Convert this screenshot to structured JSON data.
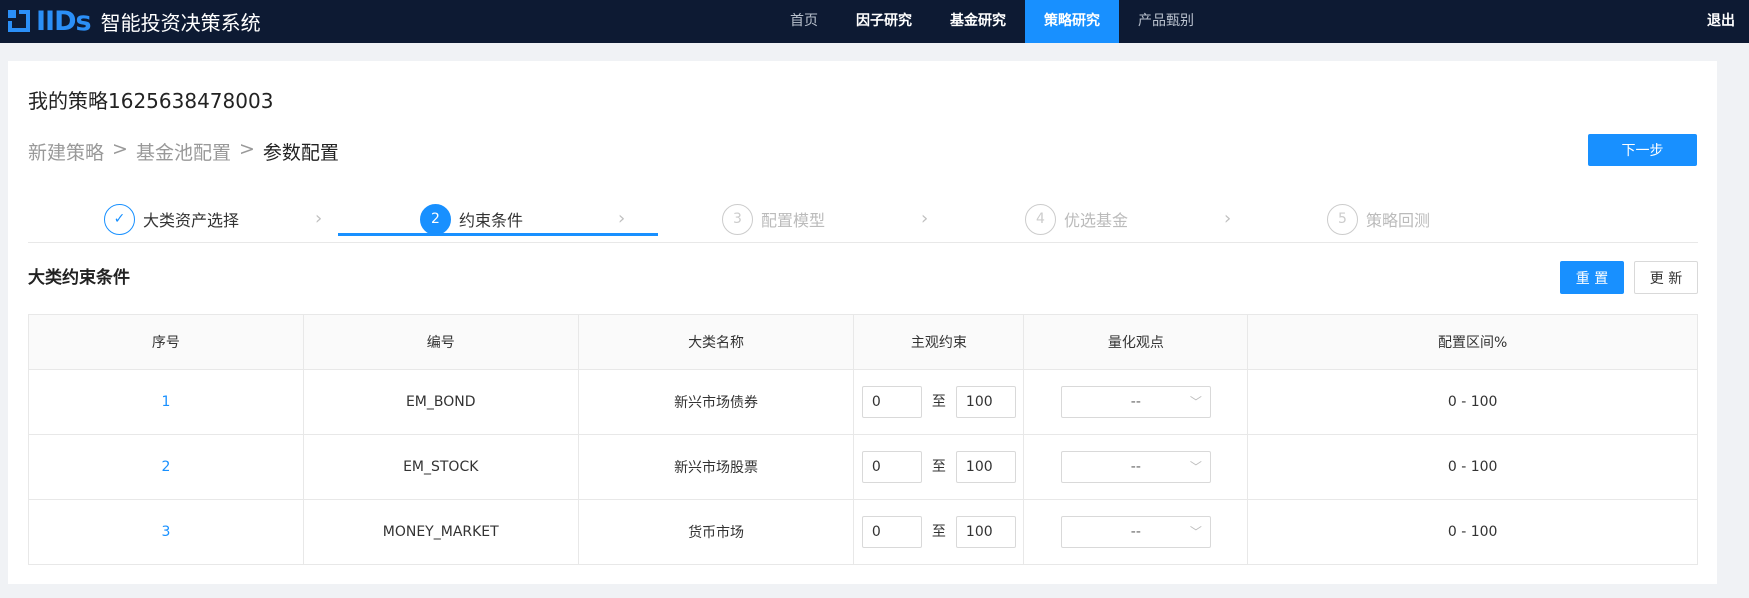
{
  "app": {
    "logo_text": "IIDs",
    "title": "智能投资决策系统",
    "logout": "退出"
  },
  "nav": [
    {
      "label": "首页",
      "state": "dim"
    },
    {
      "label": "因子研究",
      "state": "normal"
    },
    {
      "label": "基金研究",
      "state": "normal"
    },
    {
      "label": "策略研究",
      "state": "active"
    },
    {
      "label": "产品甄别",
      "state": "dim"
    }
  ],
  "page": {
    "title": "我的策略1625638478003",
    "breadcrumb": [
      "新建策略",
      "基金池配置",
      "参数配置"
    ],
    "breadcrumb_sep": ">",
    "next_button": "下一步"
  },
  "steps": [
    {
      "num": "✓",
      "label": "大类资产选择",
      "state": "done"
    },
    {
      "num": "2",
      "label": "约束条件",
      "state": "active"
    },
    {
      "num": "3",
      "label": "配置模型",
      "state": "pending"
    },
    {
      "num": "4",
      "label": "优选基金",
      "state": "pending"
    },
    {
      "num": "5",
      "label": "策略回测",
      "state": "pending"
    }
  ],
  "section": {
    "title": "大类约束条件",
    "reset_button": "重 置",
    "update_button": "更 新"
  },
  "table": {
    "headers": [
      "序号",
      "编号",
      "大类名称",
      "主观约束",
      "量化观点",
      "配置区间%"
    ],
    "range_sep": "至",
    "rows": [
      {
        "idx": "1",
        "code": "EM_BOND",
        "name": "新兴市场债券",
        "min": "0",
        "max": "100",
        "view": "--",
        "range": "0 - 100"
      },
      {
        "idx": "2",
        "code": "EM_STOCK",
        "name": "新兴市场股票",
        "min": "0",
        "max": "100",
        "view": "--",
        "range": "0 - 100"
      },
      {
        "idx": "3",
        "code": "MONEY_MARKET",
        "name": "货币市场",
        "min": "0",
        "max": "100",
        "view": "--",
        "range": "0 - 100"
      }
    ]
  },
  "colors": {
    "accent": "#1890ff",
    "topbar": "#0d1a33"
  }
}
